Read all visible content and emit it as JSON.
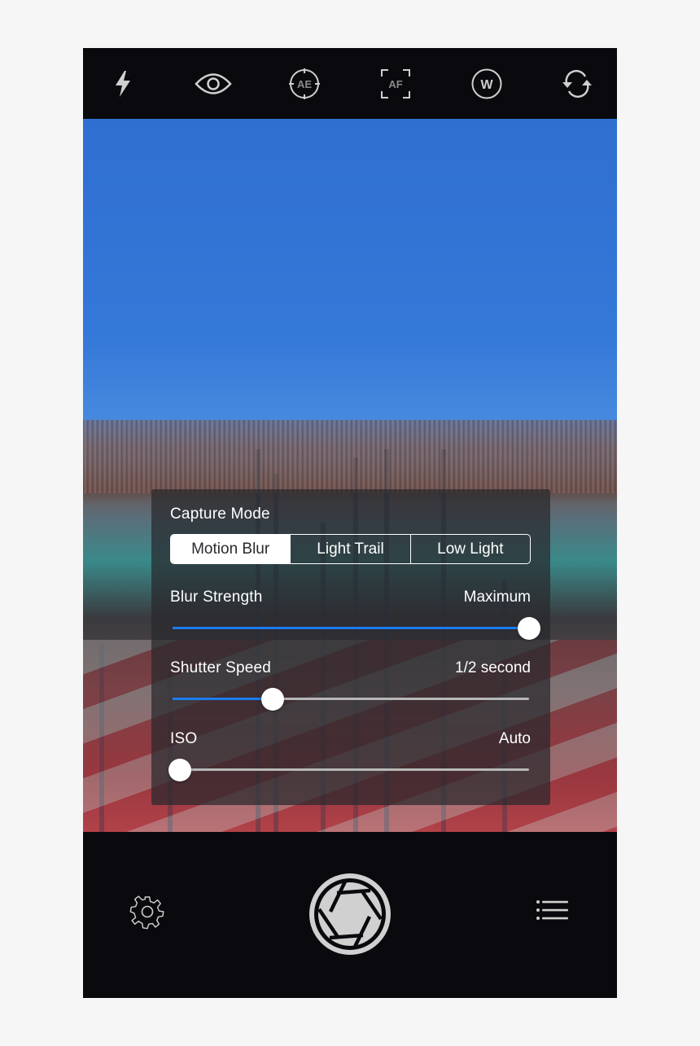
{
  "top_toolbar": {
    "icons": [
      {
        "name": "flash-icon",
        "label": ""
      },
      {
        "name": "eye-icon",
        "label": ""
      },
      {
        "name": "auto-exposure-icon",
        "label": "AE"
      },
      {
        "name": "auto-focus-icon",
        "label": "AF"
      },
      {
        "name": "white-balance-icon",
        "label": "W"
      },
      {
        "name": "switch-camera-icon",
        "label": ""
      }
    ]
  },
  "capture_panel": {
    "capture_mode_label": "Capture Mode",
    "modes": [
      "Motion Blur",
      "Light Trail",
      "Low Light"
    ],
    "selected_mode": "Motion Blur",
    "blur_strength": {
      "label": "Blur Strength",
      "value": "Maximum",
      "fraction": 1.0
    },
    "shutter_speed": {
      "label": "Shutter Speed",
      "value": "1/2 second",
      "fraction": 0.28
    },
    "iso": {
      "label": "ISO",
      "value": "Auto",
      "fraction": 0.02
    }
  },
  "colors": {
    "accent": "#1a7cf0",
    "toolbar_bg": "#0a0a0e",
    "icon": "#d0d0d0"
  },
  "bottom_toolbar": {
    "settings_icon": "gear-icon",
    "shutter_icon": "aperture-shutter-icon",
    "menu_icon": "list-icon"
  }
}
